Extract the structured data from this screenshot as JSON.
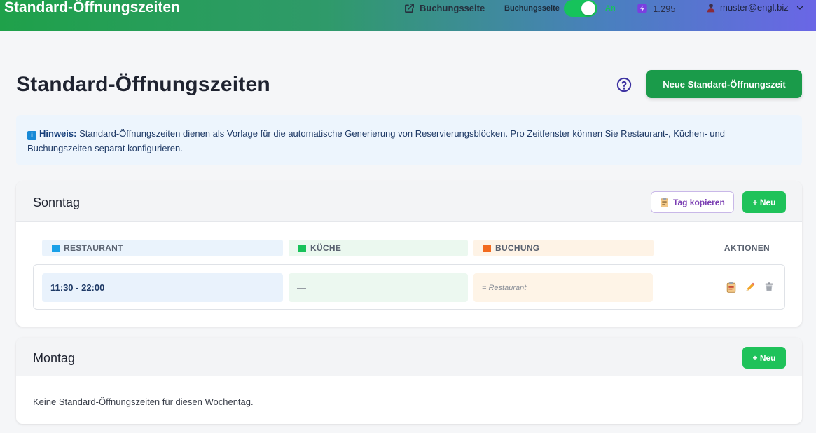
{
  "topbar": {
    "title": "Standard-Öffnungszeiten",
    "booking_link": "Buchungsseite",
    "switch_label": "Buchungsseite",
    "switch_state": "An",
    "credits": "1.295",
    "user": "muster@engl.biz"
  },
  "page": {
    "title": "Standard-Öffnungszeiten",
    "new_button": "Neue Standard-Öffnungszeit"
  },
  "notice": {
    "label": "Hinweis:",
    "text": " Standard-Öffnungszeiten dienen als Vorlage für die automatische Generierung von Reservierungsblöcken. Pro Zeitfenster können Sie Restaurant-, Küchen- und Buchungszeiten separat konfigurieren."
  },
  "columns": {
    "restaurant": "RESTAURANT",
    "kitchen": "KÜCHE",
    "booking": "BUCHUNG",
    "actions": "AKTIONEN"
  },
  "colors": {
    "restaurant": "#19a0e8",
    "kitchen": "#18c25a",
    "booking": "#f26a1e"
  },
  "days": [
    {
      "name": "Sonntag",
      "copy_label": "Tag kopieren",
      "new_label": "+ Neu",
      "slots": [
        {
          "restaurant": "11:30 - 22:00",
          "kitchen": "—",
          "booking": "= Restaurant"
        }
      ]
    },
    {
      "name": "Montag",
      "new_label": "+ Neu",
      "empty_text": "Keine Standard-Öffnungszeiten für diesen Wochentag."
    }
  ],
  "icons": {
    "external": "external-link-icon",
    "toggle": "toggle-icon",
    "credits": "credits-icon",
    "user": "user-icon",
    "help": "help-icon",
    "info": "info-icon",
    "copy": "clipboard-icon",
    "edit": "pencil-icon",
    "delete": "trash-icon"
  }
}
